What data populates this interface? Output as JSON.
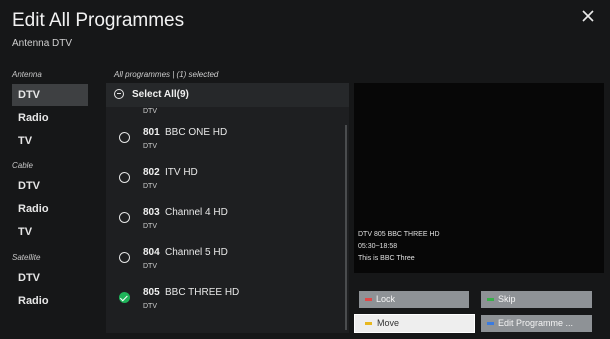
{
  "header": {
    "title": "Edit All Programmes",
    "subtitle": "Antenna DTV"
  },
  "sidebar": {
    "groups": [
      {
        "label": "Antenna",
        "items": [
          {
            "label": "DTV",
            "active": true
          },
          {
            "label": "Radio"
          },
          {
            "label": "TV"
          }
        ]
      },
      {
        "label": "Cable",
        "items": [
          {
            "label": "DTV"
          },
          {
            "label": "Radio"
          },
          {
            "label": "TV"
          }
        ]
      },
      {
        "label": "Satellite",
        "items": [
          {
            "label": "DTV"
          },
          {
            "label": "Radio"
          }
        ]
      }
    ]
  },
  "list": {
    "header": "All programmes | (1) selected",
    "select_all": "Select All(9)",
    "partial_type": "DTV",
    "rows": [
      {
        "number": "801",
        "name": "BBC ONE HD",
        "type": "DTV",
        "selected": false
      },
      {
        "number": "802",
        "name": "ITV HD",
        "type": "DTV",
        "selected": false
      },
      {
        "number": "803",
        "name": "Channel 4 HD",
        "type": "DTV",
        "selected": false
      },
      {
        "number": "804",
        "name": "Channel 5 HD",
        "type": "DTV",
        "selected": false
      },
      {
        "number": "805",
        "name": "BBC THREE HD",
        "type": "DTV",
        "selected": true
      }
    ]
  },
  "preview": {
    "line1": "DTV 805  BBC THREE HD",
    "line2": "05:30~18:58",
    "line3": "This is BBC Three"
  },
  "buttons": {
    "lock": {
      "label": "Lock",
      "key_color": "#e04848"
    },
    "skip": {
      "label": "Skip",
      "key_color": "#38b04a"
    },
    "move": {
      "label": "Move",
      "key_color": "#e8b820"
    },
    "edit": {
      "label": "Edit Programme ...",
      "key_color": "#3a7be0"
    }
  }
}
